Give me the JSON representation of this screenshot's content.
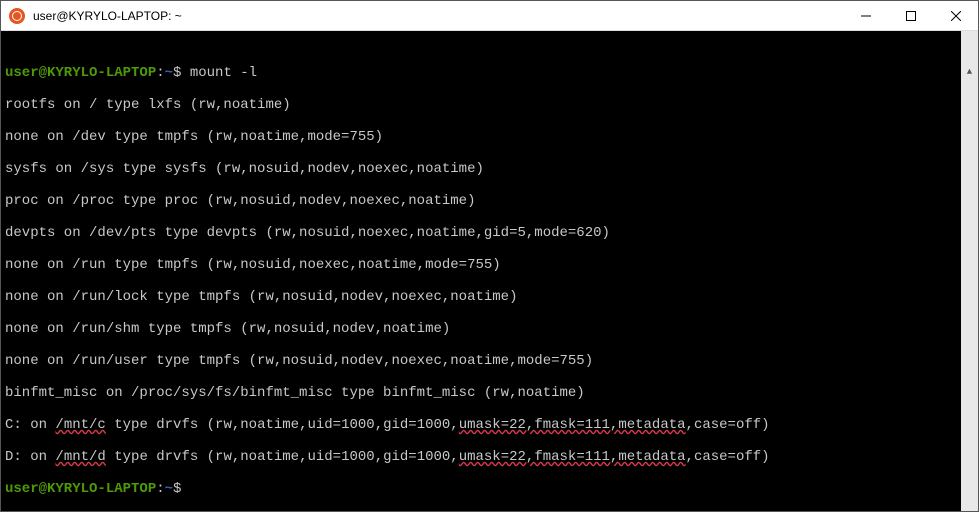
{
  "window": {
    "title": "user@KYRYLO-LAPTOP: ~"
  },
  "prompt": {
    "user_host": "user@KYRYLO-LAPTOP",
    "colon": ":",
    "path": "~",
    "dollar": "$"
  },
  "commands": {
    "cmd1": " mount -l",
    "cmd2": ""
  },
  "output": {
    "l1": "rootfs on / type lxfs (rw,noatime)",
    "l2": "none on /dev type tmpfs (rw,noatime,mode=755)",
    "l3": "sysfs on /sys type sysfs (rw,nosuid,nodev,noexec,noatime)",
    "l4": "proc on /proc type proc (rw,nosuid,nodev,noexec,noatime)",
    "l5": "devpts on /dev/pts type devpts (rw,nosuid,noexec,noatime,gid=5,mode=620)",
    "l6": "none on /run type tmpfs (rw,nosuid,noexec,noatime,mode=755)",
    "l7": "none on /run/lock type tmpfs (rw,nosuid,nodev,noexec,noatime)",
    "l8": "none on /run/shm type tmpfs (rw,nosuid,nodev,noatime)",
    "l9": "none on /run/user type tmpfs (rw,nosuid,nodev,noexec,noatime,mode=755)",
    "l10": "binfmt_misc on /proc/sys/fs/binfmt_misc type binfmt_misc (rw,noatime)",
    "c_pre": "C: on ",
    "c_mnt": "/mnt/c",
    "c_mid": " type drvfs (rw,noatime,uid=1000,gid=1000,",
    "c_umask": "umask=22,fmask=111,metadata",
    "c_post": ",case=off)",
    "d_pre": "D: on ",
    "d_mnt": "/mnt/d",
    "d_mid": " type drvfs (rw,noatime,uid=1000,gid=1000,",
    "d_umask": "umask=22,fmask=111,metadata",
    "d_post": ",case=off)"
  }
}
